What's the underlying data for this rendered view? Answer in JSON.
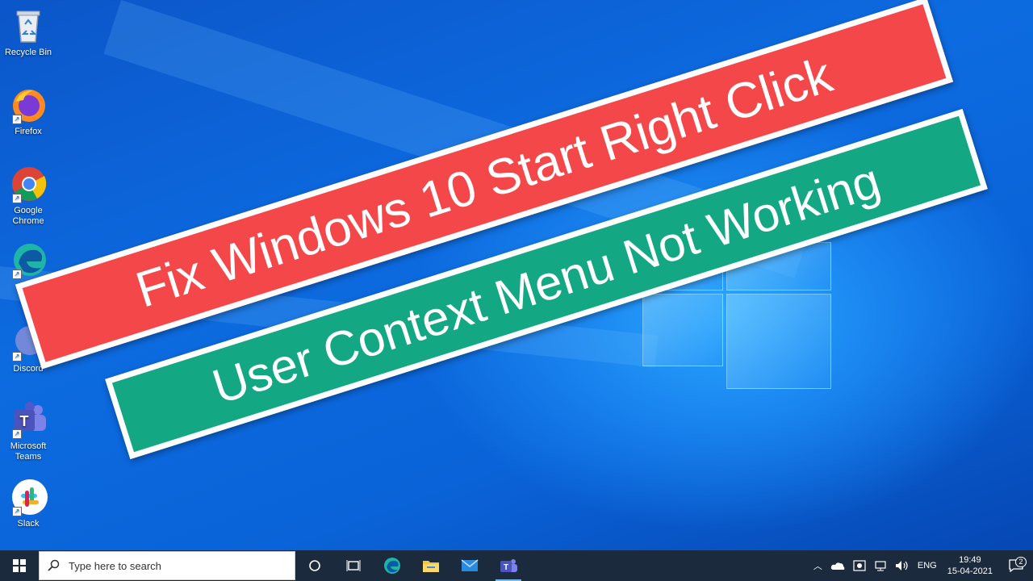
{
  "desktop_icons": [
    {
      "label": "Recycle Bin",
      "icon": "recycle-bin-icon"
    },
    {
      "label": "Firefox",
      "icon": "firefox-icon"
    },
    {
      "label": "Google Chrome",
      "icon": "chrome-icon"
    },
    {
      "label": "",
      "icon": "edge-icon"
    },
    {
      "label": "Discord",
      "icon": "discord-icon"
    },
    {
      "label": "Microsoft Teams",
      "icon": "teams-icon"
    },
    {
      "label": "Slack",
      "icon": "slack-icon"
    }
  ],
  "banners": {
    "line1": "Fix Windows 10 Start Right Click",
    "line2": "User Context Menu Not Working",
    "line1_color": "#f4474a",
    "line2_color": "#13a883"
  },
  "taskbar": {
    "search_placeholder": "Type here to search",
    "pinned": [
      "task-view-icon",
      "edge-icon",
      "file-explorer-icon",
      "mail-icon",
      "teams-icon"
    ],
    "tray": {
      "language": "ENG",
      "time": "19:49",
      "date": "15-04-2021",
      "notification_count": "2"
    }
  }
}
